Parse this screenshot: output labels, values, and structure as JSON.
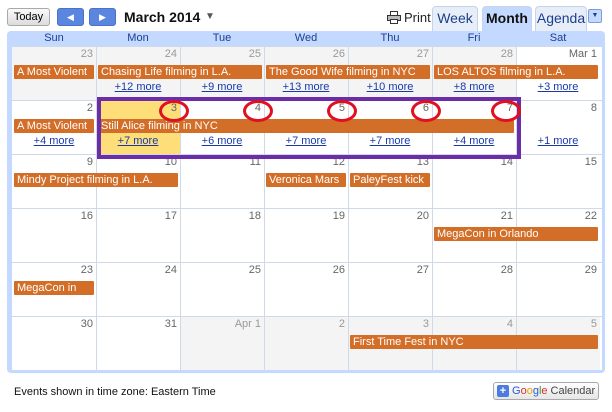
{
  "toolbar": {
    "today_label": "Today",
    "prev_icon": "◀",
    "next_icon": "▶",
    "month_title": "March 2014",
    "month_dropdown_icon": "▼",
    "print_label": "Print",
    "tabs": {
      "week": "Week",
      "month": "Month",
      "agenda": "Agenda"
    },
    "tab_dropdown_icon": "▼"
  },
  "days_of_week": [
    "Sun",
    "Mon",
    "Tue",
    "Wed",
    "Thu",
    "Fri",
    "Sat"
  ],
  "weeks": [
    {
      "days": [
        "23",
        "24",
        "25",
        "26",
        "27",
        "28",
        "Mar 1"
      ],
      "events": [
        "A Most Violent",
        "Chasing Life filming in L.A.",
        "The Good Wife filming in NYC",
        "LOS ALTOS filming in L.A."
      ],
      "more": [
        "+12 more",
        "+9 more",
        "+13 more",
        "+10 more",
        "+8 more",
        "+3 more"
      ]
    },
    {
      "days": [
        "2",
        "3",
        "4",
        "5",
        "6",
        "7",
        "8"
      ],
      "events": [
        "A Most Violent",
        "Still Alice filming in NYC"
      ],
      "more": [
        "+4 more",
        "+7 more",
        "+6 more",
        "+7 more",
        "+7 more",
        "+4 more",
        "+1 more"
      ]
    },
    {
      "days": [
        "9",
        "10",
        "11",
        "12",
        "13",
        "14",
        "15"
      ],
      "events": [
        "Mindy Project filming in L.A.",
        "Veronica Mars",
        "PaleyFest kick"
      ]
    },
    {
      "days": [
        "16",
        "17",
        "18",
        "19",
        "20",
        "21",
        "22"
      ],
      "events": [
        "MegaCon in Orlando"
      ]
    },
    {
      "days": [
        "23",
        "24",
        "25",
        "26",
        "27",
        "28",
        "29"
      ],
      "events": [
        "MegaCon in"
      ]
    },
    {
      "days": [
        "30",
        "31",
        "Apr 1",
        "2",
        "3",
        "4",
        "5"
      ],
      "events": [
        "First Time Fest in NYC"
      ]
    }
  ],
  "footer": {
    "timezone_text": "Events shown in time zone: Eastern Time",
    "gcal_plus": "+",
    "gcal_google": [
      "G",
      "o",
      "o",
      "g",
      "l",
      "e"
    ],
    "gcal_calendar": "Calendar"
  },
  "colors": {
    "event": "#d36e29",
    "today": "#fdde79",
    "frame": "#c3d9ff",
    "annotation_box": "#6b2ea8",
    "annotation_circle": "#e01020"
  }
}
